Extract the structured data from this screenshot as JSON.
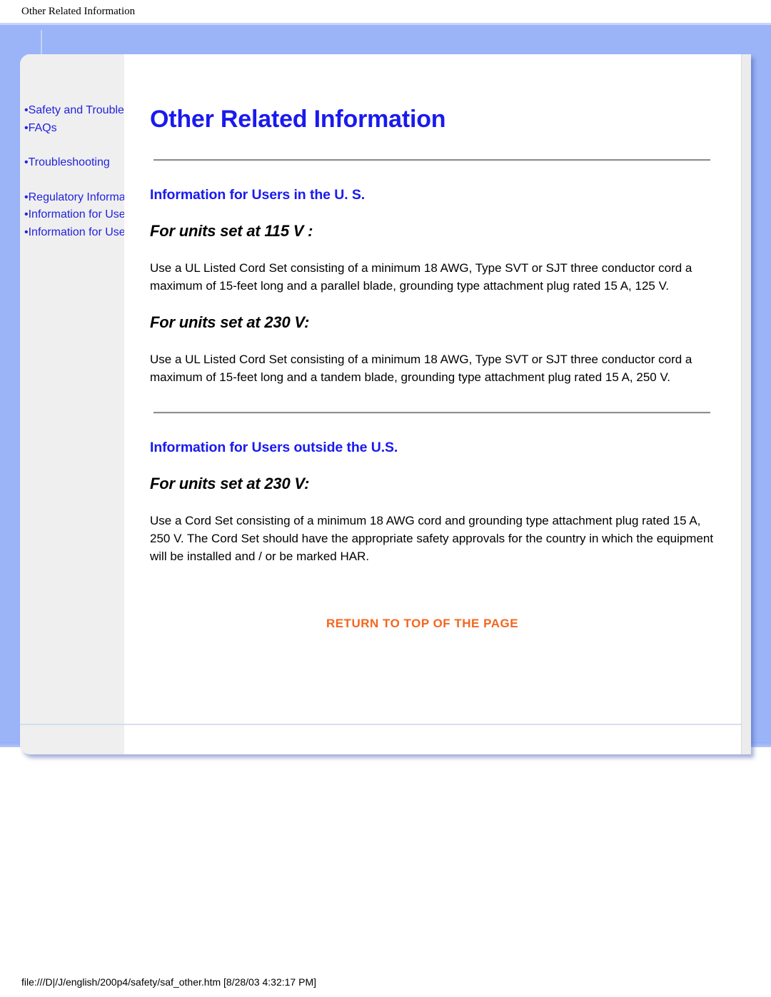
{
  "print_header": "Other Related Information",
  "print_footer": "file:///D|/J/english/200p4/safety/saf_other.htm [8/28/03 4:32:17 PM]",
  "colors": {
    "frame_blue": "#9ab4f7",
    "link_blue": "#2222dd",
    "heading_blue": "#1a1aee",
    "return_orange": "#f4661e",
    "sidebar_gray": "#efefef"
  },
  "sidebar": {
    "groups": [
      {
        "items": [
          {
            "bullet": "•",
            "label": "Safety and Troubleshooting"
          },
          {
            "bullet": "•",
            "label": "FAQs"
          }
        ]
      },
      {
        "items": [
          {
            "bullet": "•",
            "label": "Troubleshooting"
          }
        ]
      },
      {
        "items": [
          {
            "bullet": "•",
            "label": "Regulatory Information"
          },
          {
            "bullet": "•",
            "label": "Information for Users in the U.S"
          },
          {
            "bullet": "•",
            "label": "Information for Users Outside the U.S"
          }
        ]
      }
    ]
  },
  "main": {
    "title": "Other Related Information",
    "sections": [
      {
        "heading": "Information for Users in the U. S.",
        "blocks": [
          {
            "subheading": "For units set at 115 V :",
            "body": "Use a UL Listed Cord Set consisting of a minimum 18 AWG, Type SVT or SJT three conductor cord a maximum of 15-feet long and a parallel blade, grounding type attachment plug rated 15 A, 125 V."
          },
          {
            "subheading": "For units set at 230 V:",
            "body": "Use a UL Listed Cord Set consisting of a minimum 18 AWG, Type SVT or SJT three conductor cord a maximum of 15-feet long and a tandem blade, grounding type attachment plug rated 15 A, 250 V."
          }
        ]
      },
      {
        "heading": "Information for Users outside the U.S.",
        "blocks": [
          {
            "subheading": "For units set at 230 V:",
            "body": "Use a Cord Set consisting of a minimum 18 AWG cord and grounding type attachment plug rated 15 A, 250 V. The Cord Set should have the appropriate safety approvals for the country in which the equipment will be installed and / or be marked HAR."
          }
        ]
      }
    ],
    "return_link": "RETURN TO TOP OF THE PAGE"
  }
}
